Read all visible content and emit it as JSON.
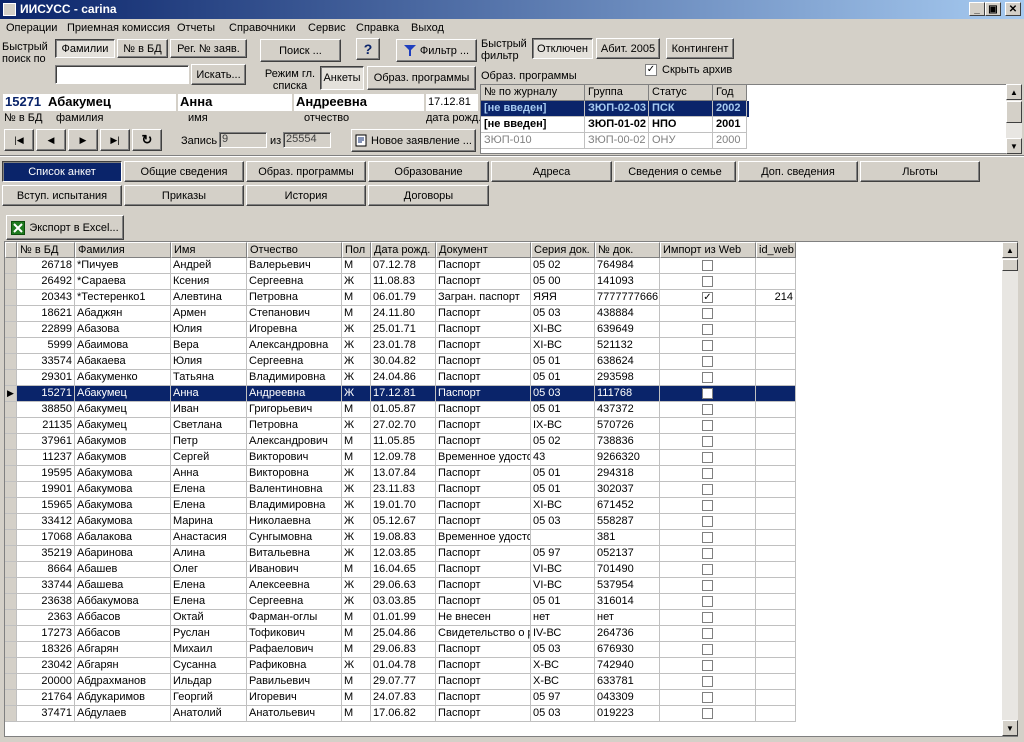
{
  "window": {
    "title": "ИИСУСС - carina",
    "min": "_",
    "max": "▣",
    "close": "✕"
  },
  "menu": [
    "Операции",
    "Приемная комиссия",
    "Отчеты",
    "Справочники",
    "Сервис",
    "Справка",
    "Выход"
  ],
  "quick_search": {
    "label": "Быстрый поиск по",
    "modes": [
      "Фамилии",
      "№ в БД",
      "Рег. № заяв."
    ],
    "value": "",
    "search_button": "Искать..."
  },
  "search_button": "Поиск ...",
  "help_button": "?",
  "filter_button": "Фильтр ...",
  "list_mode": {
    "label": "Режим гл. списка",
    "options": [
      "Анкеты",
      "Образ. программы"
    ]
  },
  "quick_filter": {
    "label": "Быстрый фильтр",
    "buttons": [
      "Отключен",
      "Абит. 2005",
      "Контингент"
    ],
    "hide_archive": "Скрыть архив",
    "hide_archive_checked": true
  },
  "edu_programs_label": "Образ. программы",
  "record": {
    "id": "15271",
    "id_label": "№ в БД",
    "surname": "Абакумец",
    "surname_label": "фамилия",
    "name": "Анна",
    "name_label": "имя",
    "patronymic": "Андреевна",
    "patronymic_label": "отчество",
    "birth": "17.12.81",
    "birth_label": "дата рожд."
  },
  "navigator": {
    "first": "|◀",
    "prev": "◀",
    "next": "▶",
    "last": "▶|",
    "refresh": "↻",
    "record_label": "Запись",
    "record_value": "9",
    "of_label": "из",
    "total": "25554"
  },
  "new_application_button": "Новое заявление ...",
  "programs": {
    "headers": [
      "№ по журналу",
      "Группа",
      "Статус",
      "Год"
    ],
    "rows": [
      [
        "[не введен]",
        "ЗЮП-02-03",
        "ПСК",
        "2002"
      ],
      [
        "[не введен]",
        "ЗЮП-01-02",
        "НПО",
        "2001"
      ],
      [
        "ЗЮП-010",
        "ЗЮП-00-02",
        "ОНУ",
        "2000"
      ]
    ]
  },
  "tabs_row1": [
    "Список анкет",
    "Общие сведения",
    "Образ. программы",
    "Образование",
    "Адреса",
    "Сведения о семье",
    "Доп. сведения",
    "Льготы"
  ],
  "tabs_row2": [
    "Вступ. испытания",
    "Приказы",
    "История",
    "Договоры"
  ],
  "export_button": "Экспорт в Excel...",
  "grid": {
    "headers": [
      "№ в БД",
      "Фамилия",
      "Имя",
      "Отчество",
      "Пол",
      "Дата рожд.",
      "Документ",
      "Серия док.",
      "№ док.",
      "Импорт из Web",
      "id_web"
    ],
    "selected_index": 8,
    "rows": [
      [
        "26718",
        "*Пичуев",
        "Андрей",
        "Валерьевич",
        "М",
        "07.12.78",
        "Паспорт",
        "05 02",
        "764984",
        "",
        ""
      ],
      [
        "26492",
        "*Сараева",
        "Ксения",
        "Сергеевна",
        "Ж",
        "11.08.83",
        "Паспорт",
        "05 00",
        "141093",
        "",
        ""
      ],
      [
        "20343",
        "*Тестеренко1",
        "Алевтина",
        "Петровна",
        "М",
        "06.01.79",
        "Загран. паспорт",
        "ЯЯЯ",
        "7777777666",
        "✓",
        "214"
      ],
      [
        "18621",
        "Абаджян",
        "Армен",
        "Степанович",
        "М",
        "24.11.80",
        "Паспорт",
        "05 03",
        "438884",
        "",
        ""
      ],
      [
        "22899",
        "Абазова",
        "Юлия",
        "Игоревна",
        "Ж",
        "25.01.71",
        "Паспорт",
        "XI-ВС",
        "639649",
        "",
        ""
      ],
      [
        "5999",
        "Абаимова",
        "Вера",
        "Александровна",
        "Ж",
        "23.01.78",
        "Паспорт",
        "XI-ВС",
        "521132",
        "",
        ""
      ],
      [
        "33574",
        "Абакаева",
        "Юлия",
        "Сергеевна",
        "Ж",
        "30.04.82",
        "Паспорт",
        "05 01",
        "638624",
        "",
        ""
      ],
      [
        "29301",
        "Абакуменко",
        "Татьяна",
        "Владимировна",
        "Ж",
        "24.04.86",
        "Паспорт",
        "05 01",
        "293598",
        "",
        ""
      ],
      [
        "15271",
        "Абакумец",
        "Анна",
        "Андреевна",
        "Ж",
        "17.12.81",
        "Паспорт",
        "05 03",
        "111768",
        "",
        ""
      ],
      [
        "38850",
        "Абакумец",
        "Иван",
        "Григорьевич",
        "М",
        "01.05.87",
        "Паспорт",
        "05 01",
        "437372",
        "",
        ""
      ],
      [
        "21135",
        "Абакумец",
        "Светлана",
        "Петровна",
        "Ж",
        "27.02.70",
        "Паспорт",
        "IX-ВС",
        "570726",
        "",
        ""
      ],
      [
        "37961",
        "Абакумов",
        "Петр",
        "Александрович",
        "М",
        "11.05.85",
        "Паспорт",
        "05 02",
        "738836",
        "",
        ""
      ],
      [
        "11237",
        "Абакумов",
        "Сергей",
        "Викторович",
        "М",
        "12.09.78",
        "Временное удосто",
        "43",
        "9266320",
        "",
        ""
      ],
      [
        "19595",
        "Абакумова",
        "Анна",
        "Викторовна",
        "Ж",
        "13.07.84",
        "Паспорт",
        "05 01",
        "294318",
        "",
        ""
      ],
      [
        "19901",
        "Абакумова",
        "Елена",
        "Валентиновна",
        "Ж",
        "23.11.83",
        "Паспорт",
        "05 01",
        "302037",
        "",
        ""
      ],
      [
        "15965",
        "Абакумова",
        "Елена",
        "Владимировна",
        "Ж",
        "19.01.70",
        "Паспорт",
        "XI-ВС",
        "671452",
        "",
        ""
      ],
      [
        "33412",
        "Абакумова",
        "Марина",
        "Николаевна",
        "Ж",
        "05.12.67",
        "Паспорт",
        "05 03",
        "558287",
        "",
        ""
      ],
      [
        "17068",
        "Абалакова",
        "Анастасия",
        "Сунгымовна",
        "Ж",
        "19.08.83",
        "Временное удосто",
        "",
        "381",
        "",
        ""
      ],
      [
        "35219",
        "Абаринова",
        "Алина",
        "Витальевна",
        "Ж",
        "12.03.85",
        "Паспорт",
        "05 97",
        "052137",
        "",
        ""
      ],
      [
        "8664",
        "Абашев",
        "Олег",
        "Иванович",
        "М",
        "16.04.65",
        "Паспорт",
        "VI-ВС",
        "701490",
        "",
        ""
      ],
      [
        "33744",
        "Абашева",
        "Елена",
        "Алексеевна",
        "Ж",
        "29.06.63",
        "Паспорт",
        "VI-ВС",
        "537954",
        "",
        ""
      ],
      [
        "23638",
        "Аббакумова",
        "Елена",
        "Сергеевна",
        "Ж",
        "03.03.85",
        "Паспорт",
        "05 01",
        "316014",
        "",
        ""
      ],
      [
        "2363",
        "Аббасов",
        "Октай",
        "Фарман-оглы",
        "М",
        "01.01.99",
        "Не внесен",
        "нет",
        "нет",
        "",
        ""
      ],
      [
        "17273",
        "Аббасов",
        "Руслан",
        "Тофикович",
        "М",
        "25.04.86",
        "Свидетельство о р",
        "IV-ВС",
        "264736",
        "",
        ""
      ],
      [
        "18326",
        "Абгарян",
        "Михаил",
        "Рафаелович",
        "М",
        "29.06.83",
        "Паспорт",
        "05 03",
        "676930",
        "",
        ""
      ],
      [
        "23042",
        "Абгарян",
        "Сусанна",
        "Рафиковна",
        "Ж",
        "01.04.78",
        "Паспорт",
        "X-ВС",
        "742940",
        "",
        ""
      ],
      [
        "20000",
        "Абдрахманов",
        "Ильдар",
        "Равильевич",
        "М",
        "29.07.77",
        "Паспорт",
        "X-ВС",
        "633781",
        "",
        ""
      ],
      [
        "21764",
        "Абдукаримов",
        "Георгий",
        "Игоревич",
        "М",
        "24.07.83",
        "Паспорт",
        "05 97",
        "043309",
        "",
        ""
      ],
      [
        "37471",
        "Абдулаев",
        "Анатолий",
        "Анатольевич",
        "М",
        "17.06.82",
        "Паспорт",
        "05 03",
        "019223",
        "",
        ""
      ]
    ]
  }
}
